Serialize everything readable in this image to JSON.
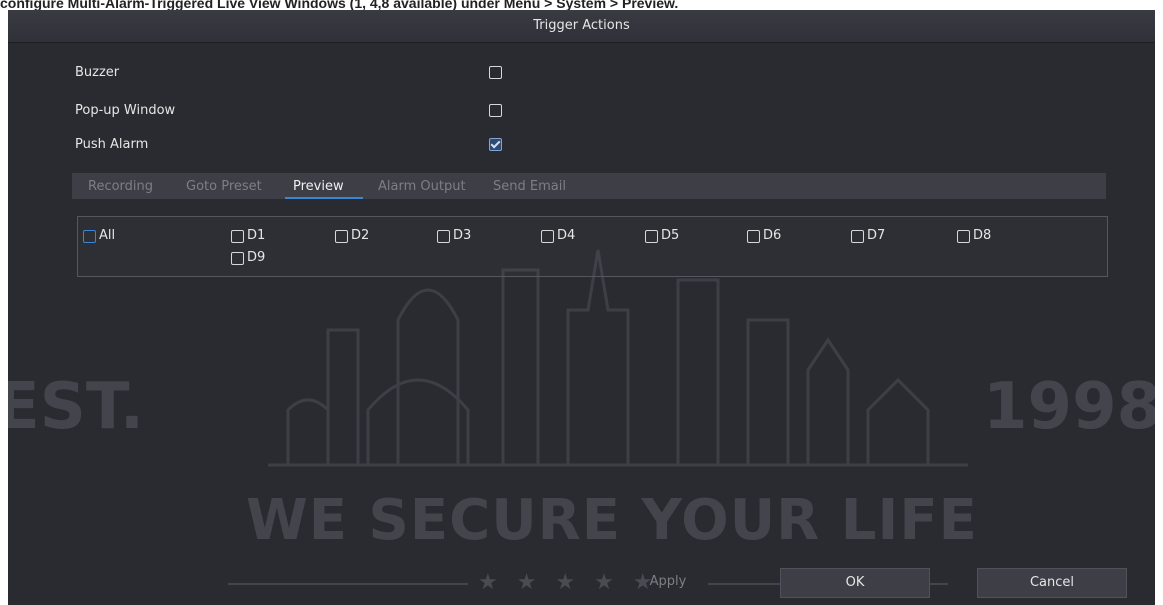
{
  "caption": "configure Multi-Alarm-Triggered Live View Windows (1, 4,8 available) under Menu > System > Preview.",
  "dialog": {
    "title": "Trigger Actions"
  },
  "options": [
    {
      "label": "Buzzer",
      "checked": false
    },
    {
      "label": "Pop-up Window",
      "checked": false
    },
    {
      "label": "Push Alarm",
      "checked": true
    }
  ],
  "tabs": [
    "Recording",
    "Goto Preset",
    "Preview",
    "Alarm Output",
    "Send Email"
  ],
  "active_tab": "Preview",
  "channels": {
    "all_label": "All",
    "items": [
      "D1",
      "D2",
      "D3",
      "D4",
      "D5",
      "D6",
      "D7",
      "D8",
      "D9"
    ]
  },
  "buttons": {
    "apply": "Apply",
    "ok": "OK",
    "cancel": "Cancel"
  },
  "watermark": {
    "left": "EST.",
    "right": "1998",
    "slogan": "WE SECURE YOUR LIFE",
    "stars": "★ ★ ★ ★ ★"
  },
  "colors": {
    "background": "#2a2b31",
    "accent": "#3a86d6",
    "text": "#e6e6e6",
    "tab_bar": "#3d3e46"
  }
}
